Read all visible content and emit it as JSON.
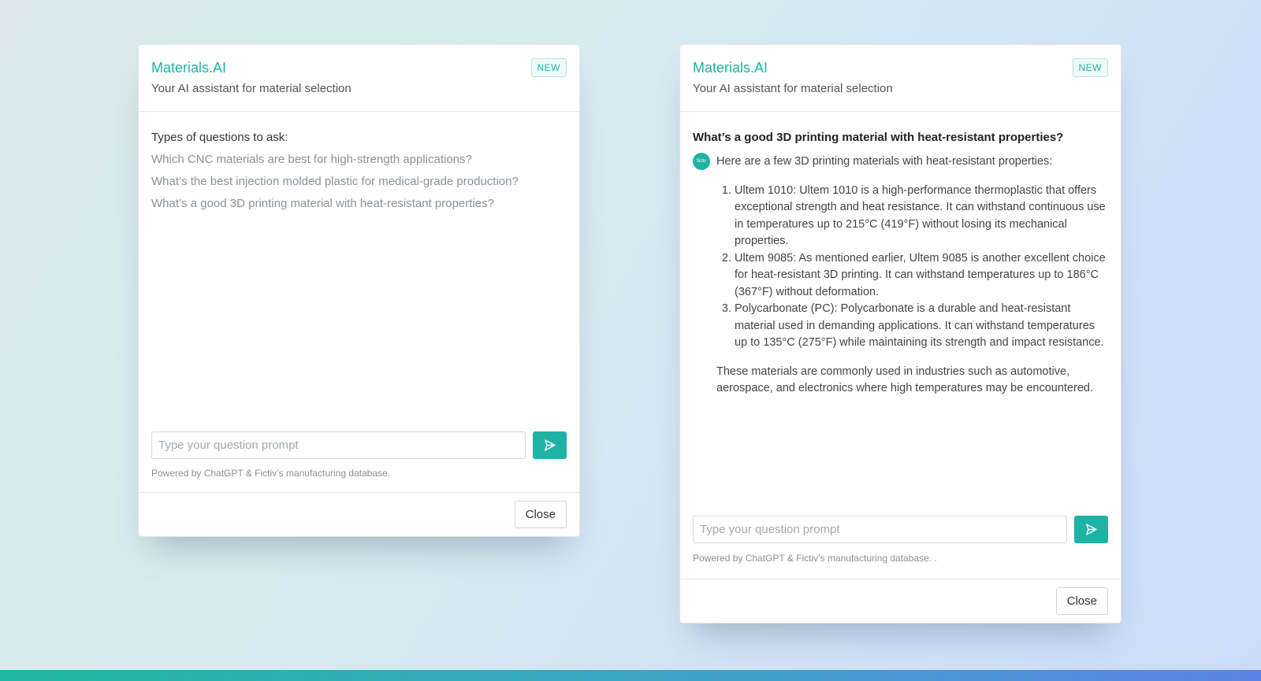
{
  "left_panel": {
    "title": "Materials.AI",
    "badge": "NEW",
    "subtitle": "Your AI assistant for material selection",
    "questions_heading": "Types of questions to ask:",
    "questions": [
      "Which CNC materials are best for high-strength applications?",
      "What’s the best injection molded plastic for medical-grade production?",
      "What’s a good 3D printing material with heat-resistant properties?"
    ],
    "input_placeholder": "Type your question prompt",
    "powered_by": "Powered by ChatGPT & Fictiv’s manufacturing database.",
    "close_label": "Close"
  },
  "right_panel": {
    "title": "Materials.AI",
    "badge": "NEW",
    "subtitle": "Your AI assistant for material selection",
    "user_question": "What’s a good 3D printing material with heat-resistant properties?",
    "avatar_label": "fictiv",
    "answer_intro": "Here are a few 3D printing materials with heat-resistant properties:",
    "answer_items": [
      "Ultem 1010: Ultem 1010 is a high-performance thermoplastic that offers exceptional strength and heat resistance. It can withstand continuous use in temperatures up to 215°C (419°F) without losing its mechanical properties.",
      "Ultem 9085: As mentioned earlier, Ultem 9085 is another excellent choice for heat-resistant 3D printing. It can withstand temperatures up to 186°C (367°F) without deformation.",
      "Polycarbonate (PC): Polycarbonate is a durable and heat-resistant material used in demanding applications. It can withstand temperatures up to 135°C (275°F) while maintaining its strength and impact resistance."
    ],
    "answer_outro": "These materials are commonly used in industries such as automotive, aerospace, and electronics where high temperatures may be encountered.",
    "input_placeholder": "Type your question prompt",
    "powered_by": "Powered by ChatGPT & Fictiv’s manufacturing database. .",
    "close_label": "Close"
  },
  "colors": {
    "accent": "#1fb3a5",
    "muted_text": "#8b9196",
    "border": "#e3e5e7"
  },
  "icons": {
    "send": "send-arrow-icon"
  }
}
